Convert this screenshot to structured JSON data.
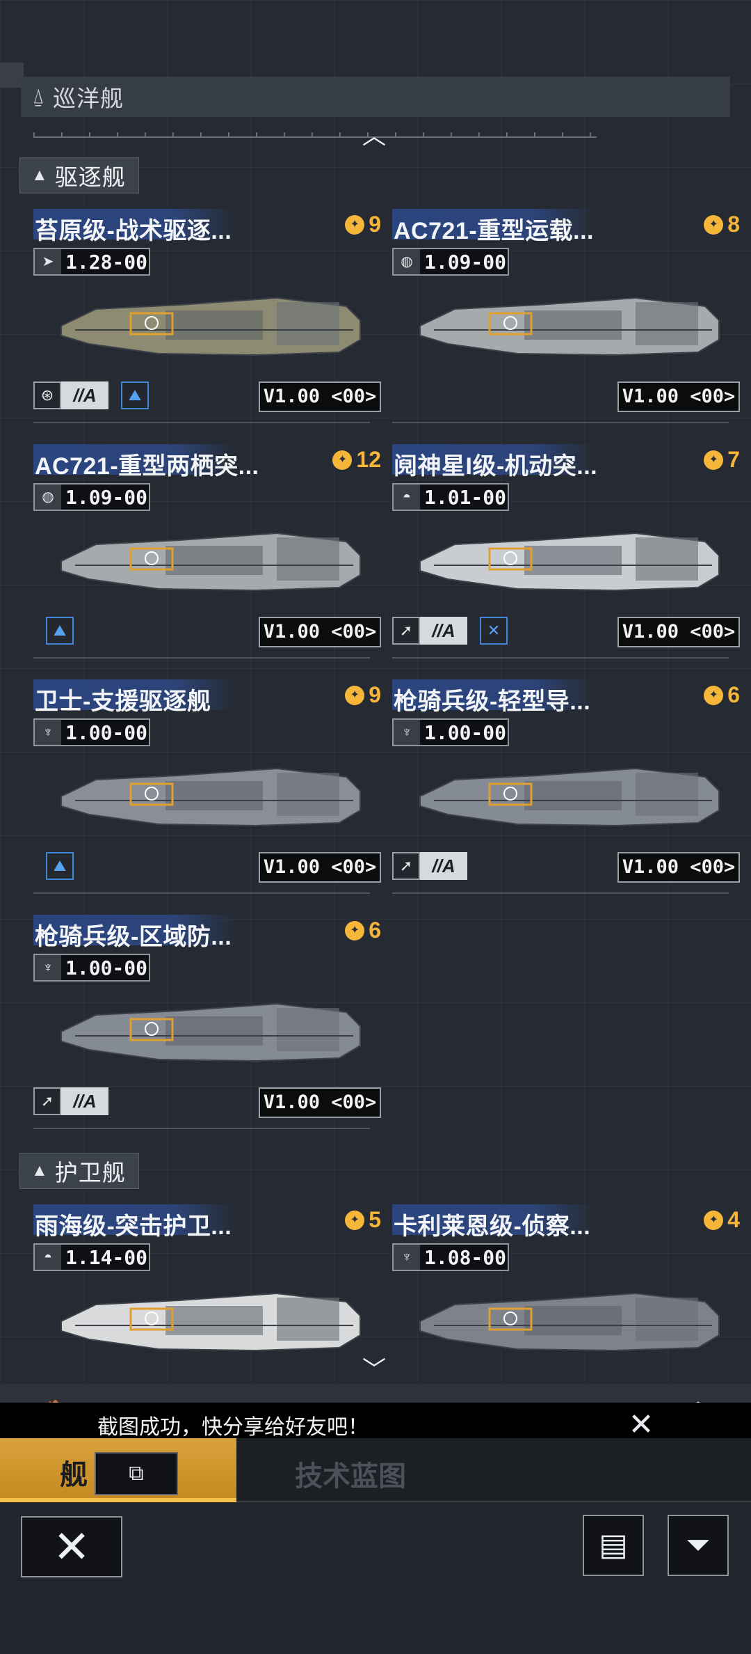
{
  "sections": {
    "cruiser": {
      "icon": "⍙",
      "label": "巡洋舰"
    },
    "destroyer": {
      "icon": "▲",
      "label": "驱逐舰"
    },
    "frigate": {
      "icon": "▲",
      "label": "护卫舰"
    }
  },
  "ships": [
    {
      "name": "苔原级-战术驱逐...",
      "rank": "9",
      "speed_icon": "thruster-icon",
      "speed": "1.28-00",
      "badges": [
        "target-icon",
        "wa-badge",
        "shield-blue-icon"
      ],
      "version": "V1.00 <00>",
      "hull": "#8d8c72"
    },
    {
      "name": "AC721-重型运载...",
      "rank": "8",
      "speed_icon": "globe-icon",
      "speed": "1.09-00",
      "badges": [],
      "version": "V1.00 <00>",
      "hull": "#a7aaad"
    },
    {
      "name": "AC721-重型两栖突...",
      "rank": "12",
      "speed_icon": "globe-icon",
      "speed": "1.09-00",
      "badges": [
        "shield-blue-icon"
      ],
      "version": "V1.00 <00>",
      "hull": "#a7aaad"
    },
    {
      "name": "阋神星I级-机动突...",
      "rank": "7",
      "speed_icon": "helmet-icon",
      "speed": "1.01-00",
      "badges": [
        "arrow-icon",
        "wa-badge",
        "cross-blue-icon"
      ],
      "version": "V1.00 <00>",
      "hull": "#c9ccd0"
    },
    {
      "name": "卫士-支援驱逐舰",
      "rank": "9",
      "speed_icon": "rocket-icon",
      "speed": "1.00-00",
      "badges": [
        "shield-blue-icon"
      ],
      "version": "V1.00 <00>",
      "hull": "#8a8f97"
    },
    {
      "name": "枪骑兵级-轻型导...",
      "rank": "6",
      "speed_icon": "rocket-icon",
      "speed": "1.00-00",
      "badges": [
        "arrow-icon",
        "wa-badge"
      ],
      "version": "V1.00 <00>",
      "hull": "#858b94"
    },
    {
      "name": "枪骑兵级-区域防...",
      "rank": "6",
      "speed_icon": "rocket-icon",
      "speed": "1.00-00",
      "badges": [
        "arrow-icon",
        "wa-badge"
      ],
      "version": "V1.00 <00>",
      "hull": "#858b94"
    },
    {
      "name": "雨海级-突击护卫...",
      "rank": "5",
      "speed_icon": "helmet-icon",
      "speed": "1.14-00",
      "badges": [],
      "version": "",
      "hull": "#d8dadc"
    },
    {
      "name": "卡利莱恩级-侦察...",
      "rank": "4",
      "speed_icon": "rocket-icon",
      "speed": "1.08-00",
      "badges": [],
      "version": "",
      "hull": "#7e838b"
    }
  ],
  "toast": {
    "text": "截图成功，快分享给好友吧！",
    "close": "✕"
  },
  "tabs": {
    "ships": "舰",
    "blueprints": "技术蓝图"
  },
  "buttons": {
    "close": "✕",
    "share": "⧉",
    "list": "▤",
    "filter": "⏷"
  },
  "nav_icons": [
    "🏠",
    "▲",
    "▲",
    "▲",
    "▲",
    "◆",
    "⬟"
  ],
  "expand_up": "︿",
  "expand_down": "﹀"
}
